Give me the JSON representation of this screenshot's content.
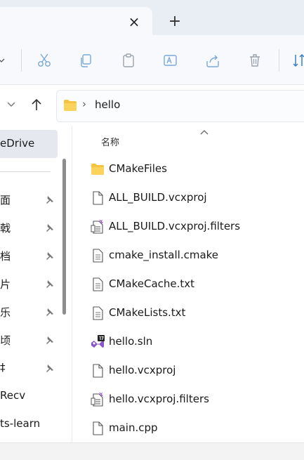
{
  "window": {
    "tab_close_glyph": "×",
    "tab_add_glyph": "+"
  },
  "toolbar": {
    "items": [
      "cut-icon",
      "copy-icon",
      "paste-icon",
      "rename-icon",
      "share-icon",
      "delete-icon",
      "sort-icon"
    ]
  },
  "address": {
    "crumb": "hello",
    "separator": "›"
  },
  "nav": {
    "selected": "eDrive",
    "items": [
      {
        "label": "面",
        "pinned": true
      },
      {
        "label": "戟",
        "pinned": true
      },
      {
        "label": "档",
        "pinned": true
      },
      {
        "label": "片",
        "pinned": true
      },
      {
        "label": "乐",
        "pinned": true
      },
      {
        "label": "顷",
        "pinned": true
      },
      {
        "label": "‡",
        "pinned": true
      },
      {
        "label": "Recv",
        "pinned": false
      },
      {
        "label": "ts-learn",
        "pinned": false
      }
    ]
  },
  "content": {
    "column_header": "名称",
    "files": [
      {
        "name": "CMakeFiles",
        "icon": "folder-icon"
      },
      {
        "name": "ALL_BUILD.vcxproj",
        "icon": "file-icon"
      },
      {
        "name": "ALL_BUILD.vcxproj.filters",
        "icon": "filters-file-icon"
      },
      {
        "name": "cmake_install.cmake",
        "icon": "text-file-icon"
      },
      {
        "name": "CMakeCache.txt",
        "icon": "text-file-icon"
      },
      {
        "name": "CMakeLists.txt",
        "icon": "text-file-icon"
      },
      {
        "name": "hello.sln",
        "icon": "visual-studio-solution-icon"
      },
      {
        "name": "hello.vcxproj",
        "icon": "file-icon"
      },
      {
        "name": "hello.vcxproj.filters",
        "icon": "filters-file-icon"
      },
      {
        "name": "main.cpp",
        "icon": "file-icon"
      }
    ]
  },
  "colors": {
    "folder": "#f5c242",
    "accent": "#0f6cbd"
  }
}
